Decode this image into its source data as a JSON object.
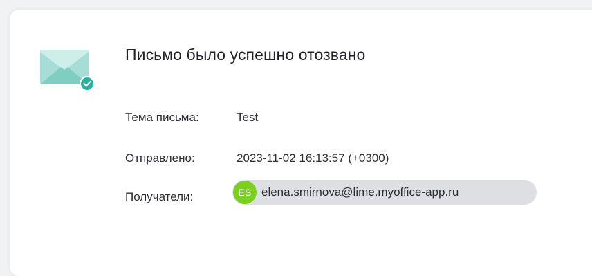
{
  "message": {
    "title": "Письмо было успешно отозвано",
    "subject_label": "Тема письма:",
    "subject_value": "Test",
    "sent_label": "Отправлено:",
    "sent_value": "2023-11-02 16:13:57 (+0300)",
    "recipients_label": "Получатели:",
    "recipients": [
      {
        "initials": "ES",
        "email": "elena.smirnova@lime.myoffice-app.ru"
      }
    ]
  },
  "icons": {
    "status": "mail-recalled-check-icon"
  },
  "colors": {
    "envelope_back": "#a6ddd6",
    "envelope_front": "#7fcec2",
    "check_badge": "#2bb09f",
    "avatar": "#7ad01c",
    "chip_bg": "#dedfe2"
  }
}
